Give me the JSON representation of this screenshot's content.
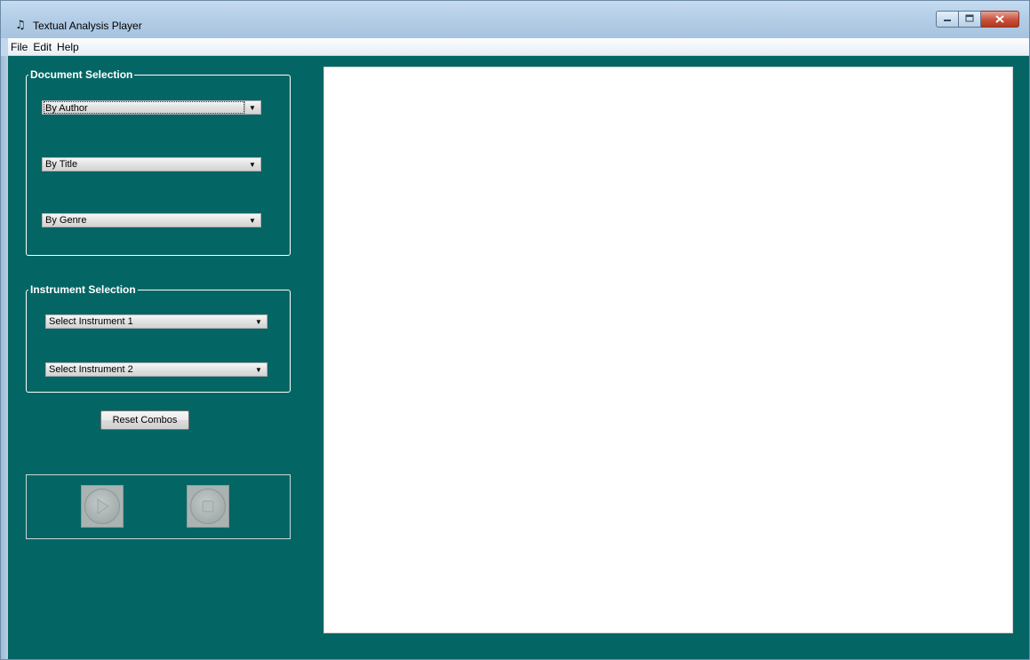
{
  "window": {
    "title": "Textual Analysis Player",
    "icon": "music-notes-icon",
    "controls": {
      "minimize": "minimize-icon",
      "maximize": "maximize-icon",
      "close": "close-icon"
    }
  },
  "menu": {
    "items": [
      {
        "label": "File"
      },
      {
        "label": "Edit"
      },
      {
        "label": "Help"
      }
    ]
  },
  "document_selection": {
    "title": "Document Selection",
    "combos": [
      {
        "value": "By Author"
      },
      {
        "value": "By Title"
      },
      {
        "value": "By Genre"
      }
    ]
  },
  "instrument_selection": {
    "title": "Instrument Selection",
    "combos": [
      {
        "value": "Select Instrument 1"
      },
      {
        "value": "Select Instrument 2"
      }
    ]
  },
  "reset_button": {
    "label": "Reset Combos"
  },
  "playback": {
    "play_icon": "play-icon",
    "stop_icon": "stop-icon"
  },
  "colors": {
    "client_background": "#046664",
    "canvas_background": "#ffffff"
  }
}
